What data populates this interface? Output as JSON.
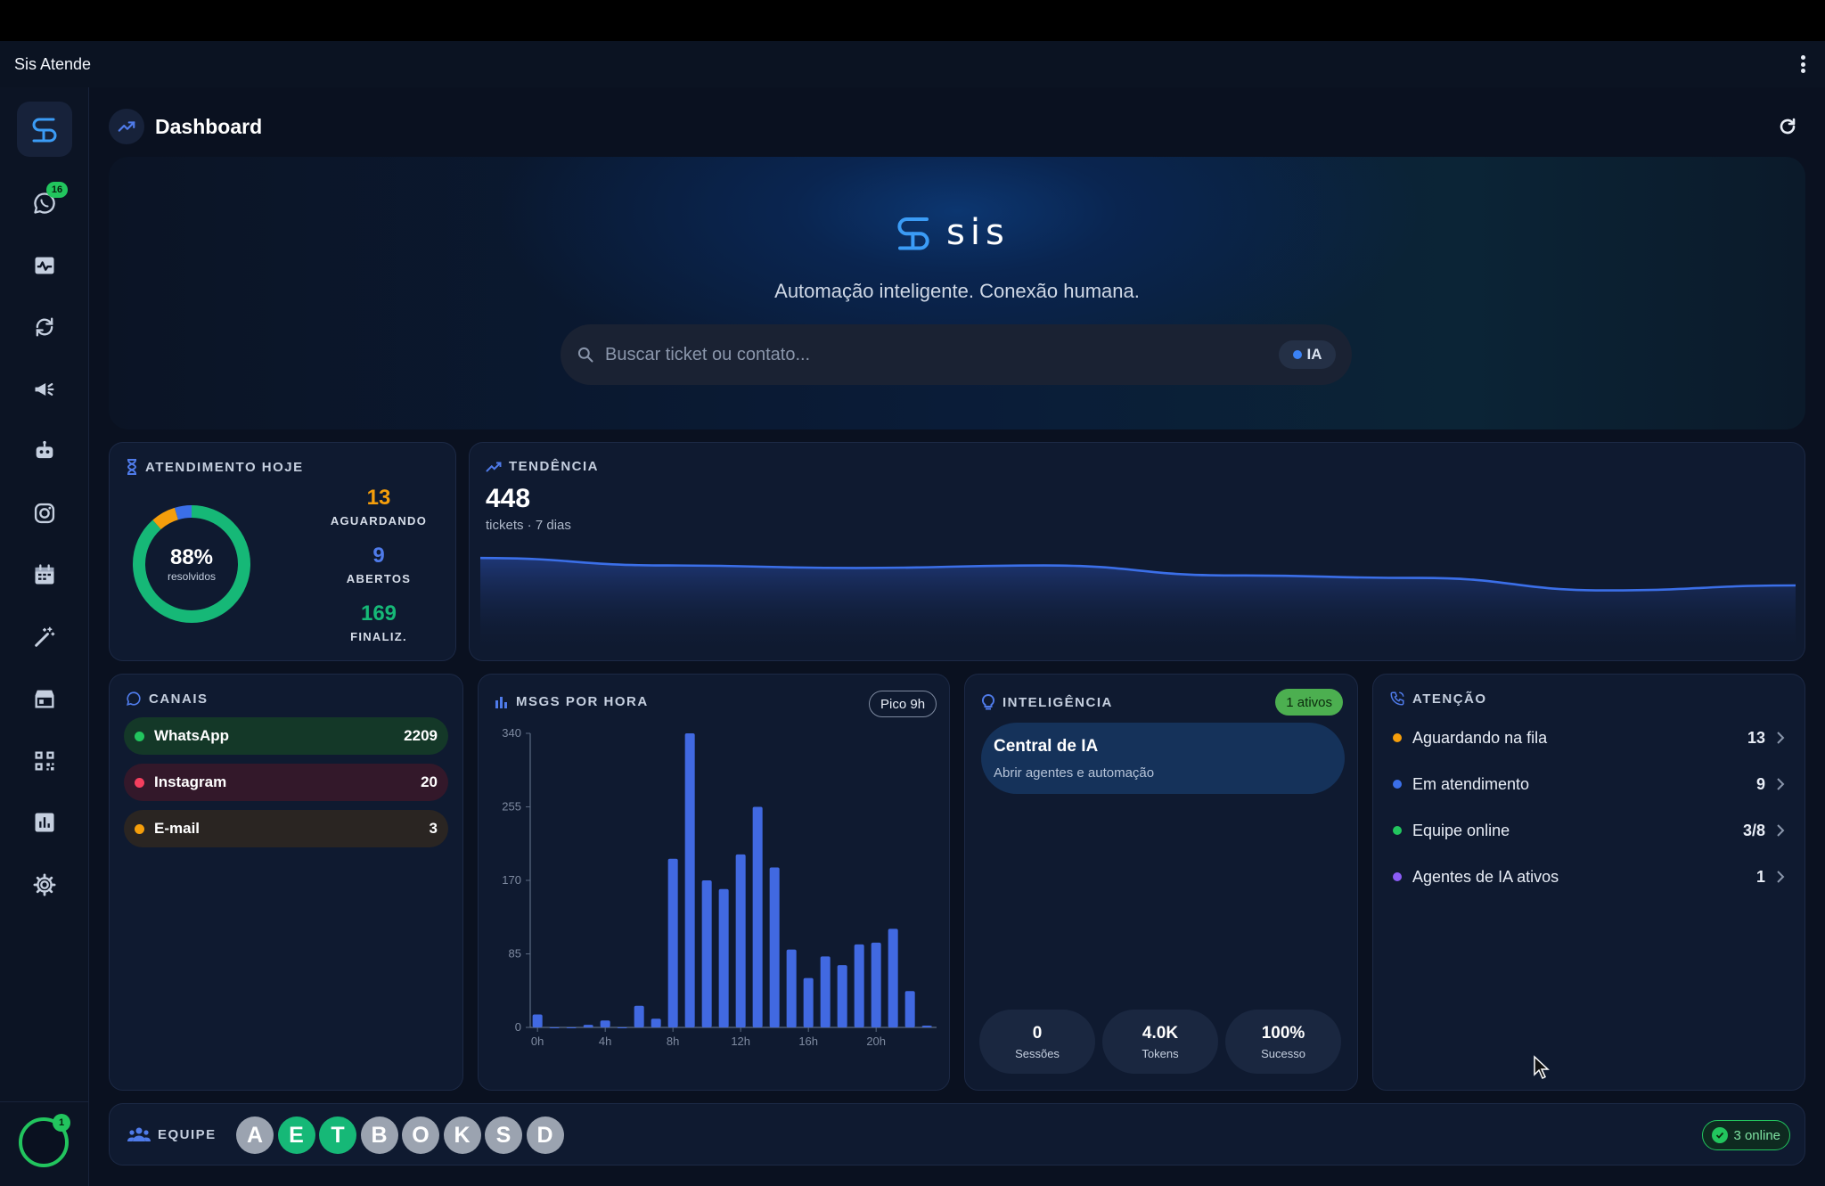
{
  "app": {
    "title": "Sis Atende"
  },
  "sidebar": {
    "whatsapp_badge": "16",
    "avatar_badge": "1",
    "items": [
      "chat-icon",
      "activity-icon",
      "sync-icon",
      "megaphone-icon",
      "robot-icon",
      "instagram-icon",
      "calendar-icon",
      "magic-wand-icon",
      "store-icon",
      "qr-code-icon",
      "bar-chart-icon",
      "settings-icon"
    ]
  },
  "header": {
    "title": "Dashboard"
  },
  "hero": {
    "brand": "sis",
    "tagline": "Automação inteligente. Conexão humana.",
    "search_placeholder": "Buscar ticket ou contato...",
    "ia_label": "IA"
  },
  "atendimento": {
    "title": "ATENDIMENTO HOJE",
    "percent": "88%",
    "percent_label": "resolvidos",
    "resolved_fraction": 0.88,
    "aguardando_value": "13",
    "aguardando_label": "AGUARDANDO",
    "abertos_value": "9",
    "abertos_label": "ABERTOS",
    "finaliz_value": "169",
    "finaliz_label": "FINALIZ."
  },
  "tendencia": {
    "title": "TENDÊNCIA",
    "value": "448",
    "subtitle": "tickets · 7 dias",
    "series": [
      76,
      73,
      72,
      73,
      69,
      68,
      63,
      65
    ]
  },
  "canais": {
    "title": "CANAIS",
    "items": [
      {
        "name": "WhatsApp",
        "value": "2209",
        "color": "#22c55e",
        "bg": "#143828"
      },
      {
        "name": "Instagram",
        "value": "20",
        "color": "#f43f5e",
        "bg": "#33182a"
      },
      {
        "name": "E-mail",
        "value": "3",
        "color": "#f59e0b",
        "bg": "#2a2522"
      }
    ]
  },
  "msgs": {
    "title": "MSGS POR HORA",
    "peak_label": "Pico 9h",
    "chart_data": {
      "type": "bar",
      "x": [
        0,
        1,
        2,
        3,
        4,
        5,
        6,
        7,
        8,
        9,
        10,
        11,
        12,
        13,
        14,
        15,
        16,
        17,
        18,
        19,
        20,
        21,
        22,
        23
      ],
      "values": [
        15,
        0,
        0,
        3,
        8,
        0,
        25,
        10,
        195,
        340,
        170,
        160,
        200,
        255,
        185,
        90,
        57,
        82,
        72,
        96,
        98,
        114,
        42,
        2
      ],
      "x_tick_labels": [
        "0h",
        "4h",
        "8h",
        "12h",
        "16h",
        "20h"
      ],
      "y_ticks": [
        "0",
        "85",
        "170",
        "255",
        "340"
      ],
      "ylim": [
        0,
        340
      ]
    }
  },
  "inteligencia": {
    "title": "INTELIGÊNCIA",
    "badge": "1 ativos",
    "box_title": "Central de IA",
    "box_sub": "Abrir agentes e automação",
    "stats": [
      {
        "value": "0",
        "label": "Sessões"
      },
      {
        "value": "4.0K",
        "label": "Tokens"
      },
      {
        "value": "100%",
        "label": "Sucesso"
      }
    ]
  },
  "atencao": {
    "title": "ATENÇÃO",
    "items": [
      {
        "label": "Aguardando na fila",
        "value": "13",
        "color": "#f59e0b"
      },
      {
        "label": "Em atendimento",
        "value": "9",
        "color": "#3b6fe8"
      },
      {
        "label": "Equipe online",
        "value": "3/8",
        "color": "#22c55e"
      },
      {
        "label": "Agentes de IA ativos",
        "value": "1",
        "color": "#8b5cf6"
      }
    ]
  },
  "equipe": {
    "title": "EQUIPE",
    "members": [
      {
        "initial": "A",
        "color": "#9ba3b0"
      },
      {
        "initial": "E",
        "color": "#16b877"
      },
      {
        "initial": "T",
        "color": "#16b877"
      },
      {
        "initial": "B",
        "color": "#9ba3b0"
      },
      {
        "initial": "O",
        "color": "#9ba3b0"
      },
      {
        "initial": "K",
        "color": "#9ba3b0"
      },
      {
        "initial": "S",
        "color": "#9ba3b0"
      },
      {
        "initial": "D",
        "color": "#9ba3b0"
      }
    ],
    "online_label": "3 online"
  }
}
